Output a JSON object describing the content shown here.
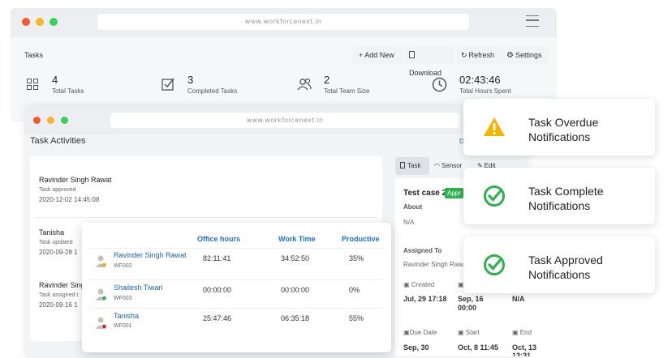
{
  "back_window": {
    "url": "www.workforcenext.in",
    "page_title": "Tasks",
    "toolbar": {
      "add_new": "+ Add New",
      "download": "Download",
      "refresh": "Refresh",
      "settings": "Settings"
    },
    "stats": [
      {
        "value": "4",
        "label": "Total Tasks",
        "icon": "grid-icon"
      },
      {
        "value": "3",
        "label": "Completed Tasks",
        "icon": "checkbox-icon"
      },
      {
        "value": "2",
        "label": "Total Team Size",
        "icon": "users-icon"
      },
      {
        "value": "02:43:46",
        "label": "Total Hours Spent",
        "icon": "clock-icon"
      }
    ]
  },
  "front_window": {
    "url": "www.workforcenext.in",
    "title": "Task Activities",
    "activities": [
      {
        "name": "Ravinder Singh Rawat",
        "action": "Task approved",
        "time": "2020-12-02 14:45:08"
      },
      {
        "name": "Tanisha",
        "action": "Task updated",
        "time": "2020-09-28 1"
      },
      {
        "name": "Ravinder Sing",
        "action": "Task assigned t",
        "time": "2020-09-16 1"
      }
    ],
    "detail": {
      "tabs": {
        "task": "Task",
        "sensor": "Sensor",
        "edit": "Edit"
      },
      "task_title": "Test case 2",
      "badge": "Appr",
      "about_label": "About",
      "about_value": "N/A",
      "assigned_label": "Assigned To",
      "assigned_value": "Ravinder Singh Rawa",
      "created_label": "Created",
      "created_value": "Jul, 29 17:18",
      "col2_value": "Sep, 16",
      "col2_value2": "00:00",
      "col3_value": "N/A",
      "due_label": "Due Date",
      "due_value": "Sep, 30",
      "start_label": "Start",
      "start_value": "Oct, 8 11:45",
      "end_label": "End",
      "end_value": "Oct, 13",
      "end_value2": "13:31"
    }
  },
  "team_table": {
    "headers": {
      "office": "Office hours",
      "work": "Work Time",
      "productive": "Productive"
    },
    "rows": [
      {
        "name": "Ravinder Singh Rawat",
        "id": "WF002",
        "office": "82:11:41",
        "work": "34:52:50",
        "productive": "35%",
        "status_color": "#f0a500"
      },
      {
        "name": "Shailesh Tiwari",
        "id": "WF003",
        "office": "00:00:00",
        "work": "00:00:00",
        "productive": "0%",
        "status_color": "#2bb24c"
      },
      {
        "name": "Tanisha",
        "id": "WF001",
        "office": "25:47:46",
        "work": "06:35:18",
        "productive": "55%",
        "status_color": "#e02020"
      }
    ]
  },
  "notifications": [
    {
      "line1": "Task Overdue",
      "line2": "Notifications",
      "icon": "warning-icon"
    },
    {
      "line1": "Task Complete",
      "line2": "Notifications",
      "icon": "check-circle-icon"
    },
    {
      "line1": "Task Approved",
      "line2": "Notifications",
      "icon": "check-circle-icon"
    }
  ],
  "colors": {
    "accent_blue": "#1f6fd6",
    "green": "#2bb24c",
    "warning": "#f5b400",
    "dot_red": "#f35b2a",
    "dot_yellow": "#f7b52c",
    "dot_green": "#3ccf5b"
  }
}
